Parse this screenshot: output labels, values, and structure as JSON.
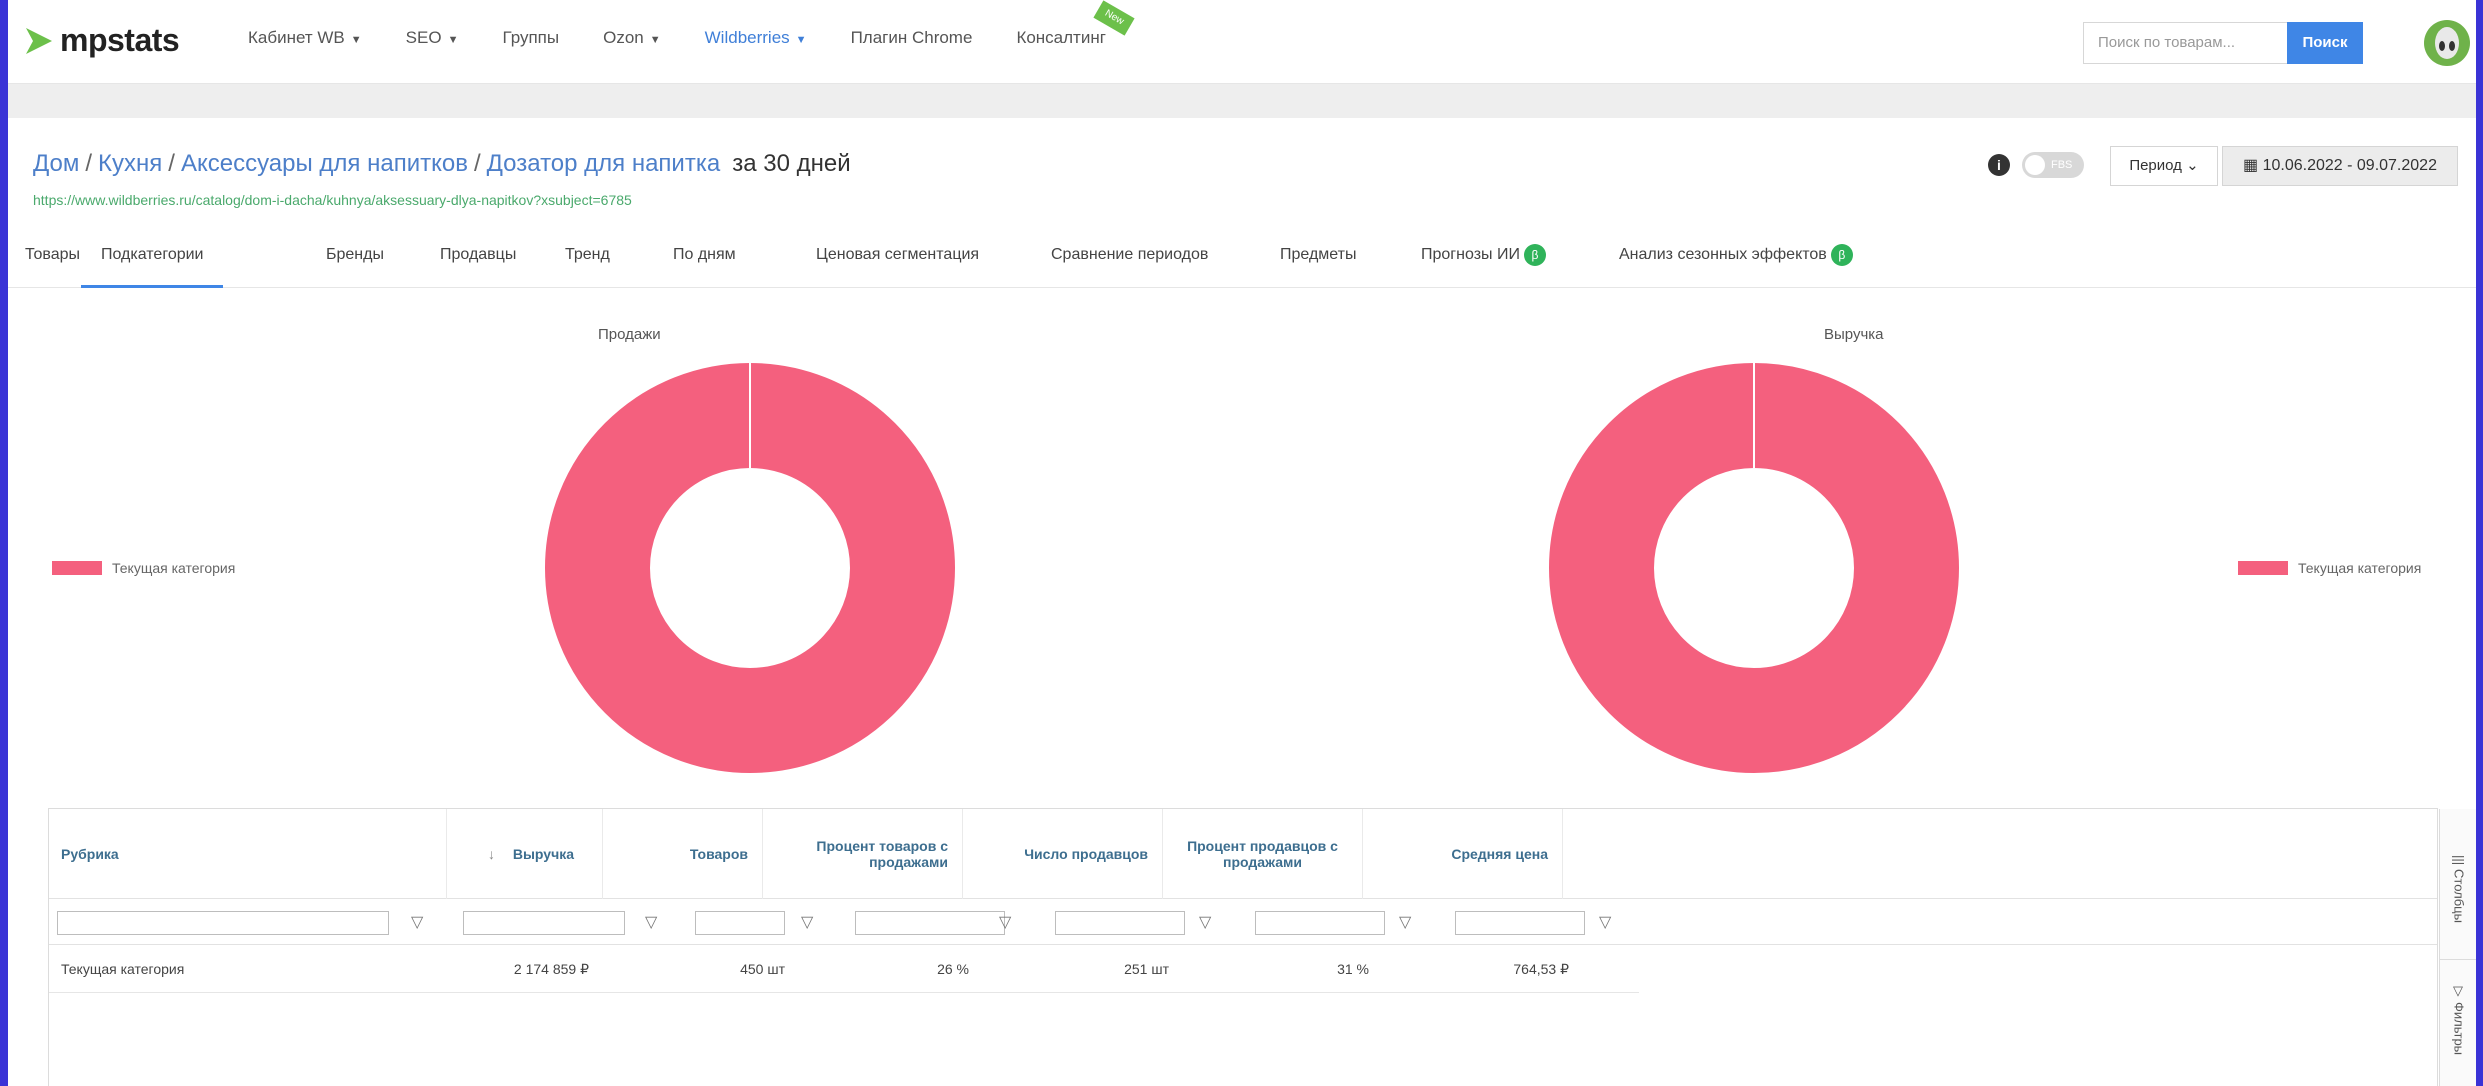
{
  "brand": {
    "name": "mpstats",
    "color": "#6cc04a"
  },
  "nav": {
    "items": [
      {
        "label": "Кабинет WB",
        "dropdown": true
      },
      {
        "label": "SEO",
        "dropdown": true
      },
      {
        "label": "Группы",
        "dropdown": false
      },
      {
        "label": "Ozon",
        "dropdown": true
      },
      {
        "label": "Wildberries",
        "dropdown": true,
        "active": true
      },
      {
        "label": "Плагин Chrome",
        "dropdown": false
      },
      {
        "label": "Консалтинг",
        "dropdown": false,
        "badge": "New"
      }
    ],
    "search_placeholder": "Поиск по товарам...",
    "search_button": "Поиск"
  },
  "header": {
    "breadcrumb": [
      "Дом",
      "Кухня",
      "Аксессуары для напитков",
      "Дозатор для напитка"
    ],
    "period_text": "за 30 дней",
    "url": "https://www.wildberries.ru/catalog/dom-i-dacha/kuhnya/aksessuary-dlya-napitkov?xsubject=6785",
    "info_icon": "i",
    "fbs_label": "FBS",
    "period_button": "Период",
    "date_range": "10.06.2022 - 09.07.2022"
  },
  "tabs": [
    {
      "label": "Товары"
    },
    {
      "label": "Подкатегории",
      "active": true
    },
    {
      "label": "Бренды"
    },
    {
      "label": "Продавцы"
    },
    {
      "label": "Тренд"
    },
    {
      "label": "По дням"
    },
    {
      "label": "Ценовая сегментация"
    },
    {
      "label": "Сравнение периодов"
    },
    {
      "label": "Предметы"
    },
    {
      "label": "Прогнозы ИИ",
      "beta": "β"
    },
    {
      "label": "Анализ сезонных эффектов",
      "beta": "β"
    }
  ],
  "chart_data": [
    {
      "type": "pie",
      "title": "Продажи",
      "categories": [
        "Текущая категория"
      ],
      "values": [
        100
      ],
      "colors": [
        "#f4607e"
      ],
      "legend": "left"
    },
    {
      "type": "pie",
      "title": "Выручка",
      "categories": [
        "Текущая категория"
      ],
      "values": [
        100
      ],
      "colors": [
        "#f4607e"
      ],
      "legend": "right"
    }
  ],
  "table": {
    "columns": [
      {
        "label": "Рубрика",
        "sort": ""
      },
      {
        "label": "Выручка",
        "sort": "↓"
      },
      {
        "label": "Товаров",
        "sort": ""
      },
      {
        "label": "Процент товаров с продажами",
        "sort": ""
      },
      {
        "label": "Число продавцов",
        "sort": ""
      },
      {
        "label": "Процент продавцов с продажами",
        "sort": ""
      },
      {
        "label": "Средняя цена",
        "sort": ""
      }
    ],
    "rows": [
      [
        "Текущая категория",
        "2 174 859 ₽",
        "450 шт",
        "26 %",
        "251 шт",
        "31 %",
        "764,53 ₽"
      ]
    ],
    "side_tabs": [
      "Столбцы",
      "Фильтры"
    ]
  }
}
